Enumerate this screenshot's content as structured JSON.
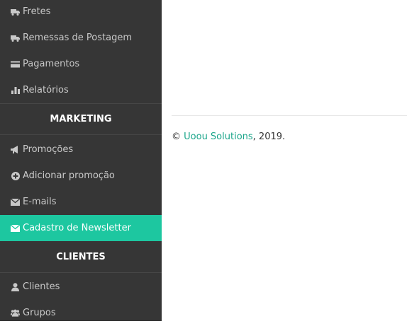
{
  "sidebar": {
    "items": [
      {
        "label": "Fretes",
        "icon": "truck-icon"
      },
      {
        "label": "Remessas de Postagem",
        "icon": "truck-icon"
      },
      {
        "label": "Pagamentos",
        "icon": "credit-card-icon"
      },
      {
        "label": "Relatórios",
        "icon": "bar-chart-icon"
      }
    ],
    "marketing": {
      "title": "MARKETING",
      "items": [
        {
          "label": "Promoções",
          "icon": "bullhorn-icon"
        },
        {
          "label": "Adicionar promoção",
          "icon": "plus-circle-icon"
        },
        {
          "label": "E-mails",
          "icon": "envelope-icon"
        },
        {
          "label": "Cadastro de Newsletter",
          "icon": "envelope-icon",
          "active": true
        }
      ]
    },
    "clientes": {
      "title": "CLIENTES",
      "items": [
        {
          "label": "Clientes",
          "icon": "user-icon"
        },
        {
          "label": "Grupos",
          "icon": "users-icon"
        }
      ]
    }
  },
  "footer": {
    "copyright": "©",
    "link": "Uoou Solutions",
    "year": ", 2019."
  },
  "colors": {
    "sidebar_bg": "#363636",
    "active_bg": "#1dc7a0",
    "link": "#1aa58a"
  }
}
